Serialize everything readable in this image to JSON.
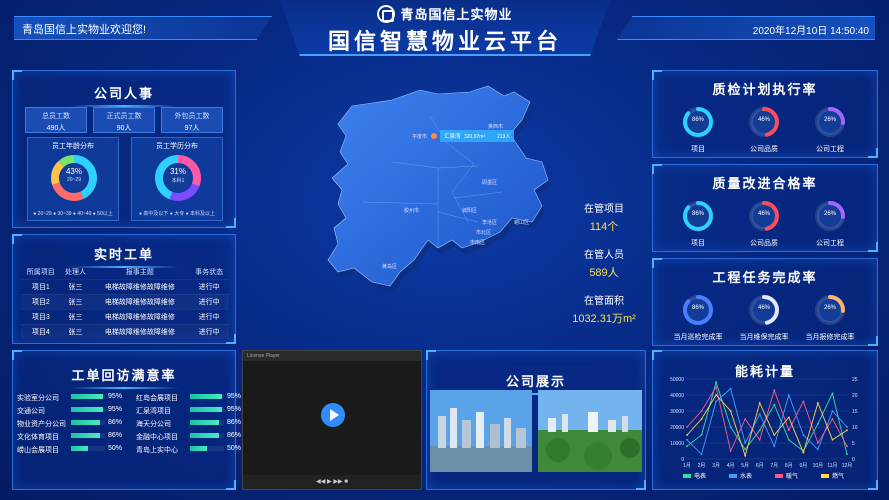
{
  "header": {
    "welcome": "青岛国信上实物业欢迎您!",
    "company": "青岛国信上实物业",
    "title": "国信智慧物业云平台",
    "datetime": "2020年12月10日  14:50:40"
  },
  "staff": {
    "title": "公司人事",
    "stats": [
      {
        "label": "总员工数",
        "value": "490人"
      },
      {
        "label": "正式员工数",
        "value": "90人"
      },
      {
        "label": "外包员工数",
        "value": "97人"
      }
    ],
    "age": {
      "title": "员工年龄分布",
      "center_value": "43%",
      "center_label": "20~29",
      "legend": "● 20~29  ● 30~39  ● 40~49  ● 50以上",
      "colors": [
        "#2fd0ff",
        "#ff6a6a",
        "#ffc24a",
        "#7be36b"
      ],
      "fractions": [
        0.43,
        0.27,
        0.18,
        0.12
      ]
    },
    "edu": {
      "title": "员工学历分布",
      "center_value": "31%",
      "center_label": "本科1",
      "legend": "● 高中及以下  ● 大专  ● 本科及以上",
      "colors": [
        "#ff5aa6",
        "#7a4dff",
        "#2fd0ff"
      ],
      "fractions": [
        0.31,
        0.25,
        0.44
      ]
    }
  },
  "orders": {
    "title": "实时工单",
    "columns": [
      "所属项目",
      "处理人",
      "报事主题",
      "事务状态"
    ],
    "rows": [
      [
        "项目1",
        "张三",
        "电梯故障维修故障维修",
        "进行中"
      ],
      [
        "项目2",
        "张三",
        "电梯故障维修故障维修",
        "进行中"
      ],
      [
        "项目3",
        "张三",
        "电梯故障维修故障维修",
        "进行中"
      ],
      [
        "项目4",
        "张三",
        "电梯故障维修故障维修",
        "进行中"
      ]
    ]
  },
  "satisfaction": {
    "title": "工单回访满意率",
    "left": [
      {
        "name": "实验室分公司",
        "pct": "95%",
        "v": 0.95
      },
      {
        "name": "交通公司",
        "pct": "95%",
        "v": 0.95
      },
      {
        "name": "物业资产分公司",
        "pct": "86%",
        "v": 0.86
      },
      {
        "name": "文化体育项目",
        "pct": "86%",
        "v": 0.86
      },
      {
        "name": "崂山会展项目",
        "pct": "50%",
        "v": 0.5
      }
    ],
    "right": [
      {
        "name": "红岛会展项目",
        "pct": "95%",
        "v": 0.95
      },
      {
        "name": "汇泉湾项目",
        "pct": "95%",
        "v": 0.95
      },
      {
        "name": "海天分公司",
        "pct": "86%",
        "v": 0.86
      },
      {
        "name": "金融中心项目",
        "pct": "86%",
        "v": 0.86
      },
      {
        "name": "青岛上实中心",
        "pct": "50%",
        "v": 0.5
      }
    ]
  },
  "map": {
    "tip_city": "平度市",
    "tip_name": "汇泉湾",
    "tip_area": "320.97m²",
    "tip_count": "213人",
    "districts": [
      "莱西市",
      "即墨区",
      "胶州市",
      "城阳区",
      "李沧区",
      "崂山区",
      "市北区",
      "市南区",
      "黄岛区"
    ],
    "managed_projects_label": "在管项目",
    "managed_projects_value": "114个",
    "managed_staff_label": "在管人员",
    "managed_staff_value": "589人",
    "managed_area_label": "在管面积",
    "managed_area_value": "1032.31万m²"
  },
  "video": {
    "window_title": "License Player",
    "controls": "◀◀  ▶  ▶▶  ■"
  },
  "show": {
    "title": "公司展示"
  },
  "kpis": [
    {
      "title": "质检计划执行率",
      "items": [
        {
          "label": "项目",
          "pct": "86%",
          "v": 0.86,
          "color": "#2fd0ff"
        },
        {
          "label": "公司品质",
          "pct": "46%",
          "v": 0.46,
          "color": "#ff4a5a"
        },
        {
          "label": "公司工程",
          "pct": "26%",
          "v": 0.26,
          "color": "#a066ff"
        }
      ]
    },
    {
      "title": "质量改进合格率",
      "items": [
        {
          "label": "项目",
          "pct": "86%",
          "v": 0.86,
          "color": "#2fd0ff"
        },
        {
          "label": "公司品质",
          "pct": "46%",
          "v": 0.46,
          "color": "#ff4a5a"
        },
        {
          "label": "公司工程",
          "pct": "26%",
          "v": 0.26,
          "color": "#a066ff"
        }
      ]
    },
    {
      "title": "工程任务完成率",
      "items": [
        {
          "label": "当月巡检完成率",
          "pct": "86%",
          "v": 0.86,
          "color": "#4a7dff"
        },
        {
          "label": "当月维保完成率",
          "pct": "46%",
          "v": 0.46,
          "color": "#e6e6ff"
        },
        {
          "label": "当月报修完成率",
          "pct": "26%",
          "v": 0.26,
          "color": "#ffb46b"
        }
      ]
    }
  ],
  "chart_data": {
    "type": "line",
    "title": "能耗计量",
    "categories": [
      "1月",
      "2月",
      "3月",
      "4月",
      "5月",
      "6月",
      "7月",
      "8月",
      "9月",
      "10月",
      "11月",
      "12月"
    ],
    "yleft": {
      "ticks": [
        "0",
        "10000",
        "20000",
        "30000",
        "40000",
        "50000"
      ],
      "ylim": [
        0,
        50000
      ]
    },
    "yright": {
      "ticks": [
        "0",
        "5",
        "10",
        "15",
        "20",
        "25"
      ],
      "ylim": [
        0,
        25
      ]
    },
    "series": [
      {
        "name": "电表",
        "color": "#2fe0a0",
        "values": [
          8000,
          15000,
          48000,
          20000,
          6000,
          18000,
          34000,
          12000,
          5000,
          22000,
          41000,
          3000
        ]
      },
      {
        "name": "水表",
        "color": "#3fa0ff",
        "values": [
          12000,
          3000,
          36000,
          44000,
          10000,
          28000,
          8000,
          40000,
          15000,
          6000,
          30000,
          20000
        ]
      },
      {
        "name": "暖气",
        "color": "#ff5a8a",
        "values": [
          20000,
          30000,
          45000,
          5000,
          25000,
          12000,
          43000,
          18000,
          36000,
          10000,
          25000,
          8000
        ]
      },
      {
        "name": "燃气",
        "color": "#ffd54a",
        "values": [
          15000,
          25000,
          40000,
          30000,
          2000,
          35000,
          15000,
          26000,
          4000,
          35000,
          12000,
          18000
        ]
      }
    ],
    "legend": "bottom"
  }
}
